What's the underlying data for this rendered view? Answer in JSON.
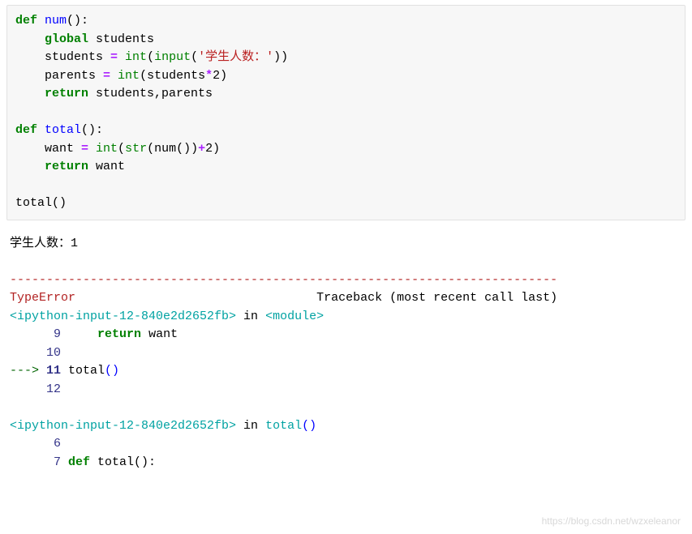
{
  "code": {
    "l1_def": "def ",
    "l1_fn": "num",
    "l1_rest": "():",
    "l2_global": "global ",
    "l2_var": "students",
    "l3_p1": "    students ",
    "l3_eq": "= ",
    "l3_int": "int",
    "l3_p2": "(",
    "l3_input": "input",
    "l3_p3": "(",
    "l3_str": "'学生人数：'",
    "l3_p4": "))",
    "l4_p1": "    parents ",
    "l4_eq": "= ",
    "l4_int": "int",
    "l4_p2": "(students",
    "l4_star": "*",
    "l4_p3": "2)",
    "l5_ret": "return ",
    "l5_rest": "students,parents",
    "l7_def": "def ",
    "l7_fn": "total",
    "l7_rest": "():",
    "l8_p1": "    want ",
    "l8_eq": "= ",
    "l8_int": "int",
    "l8_p2": "(",
    "l8_str": "str",
    "l8_p3": "(num())",
    "l8_plus": "+",
    "l8_p4": "2)",
    "l9_ret": "return ",
    "l9_rest": "want",
    "l11": "total()"
  },
  "output": {
    "stdin_line": "学生人数：1",
    "hr_chars": "---------------------------------------------------------------------------",
    "err_name": "TypeError",
    "tb_label": "                                 Traceback (most recent call last)",
    "src1_a": "<ipython-input-12-840e2d2652fb>",
    "src1_in": " in ",
    "src1_b": "<module>",
    "frame1_l9_pad": "      ",
    "frame1_l9_ln": "9",
    "frame1_l9_code_pre": "     ",
    "frame1_l9_ret": "return ",
    "frame1_l9_rest": "want",
    "frame1_l10_pad": "     ",
    "frame1_l10_ln": "10",
    "frame1_arrow": "---> ",
    "frame1_l11_ln": "11 ",
    "frame1_l11_code_p1": "total",
    "frame1_l11_code_p2": "()",
    "frame1_l12_pad": "     ",
    "frame1_l12_ln": "12",
    "src2_a": "<ipython-input-12-840e2d2652fb>",
    "src2_in": " in ",
    "src2_b": "total",
    "src2_b2": "()",
    "frame2_l6_pad": "      ",
    "frame2_l6_ln": "6",
    "frame2_l7_pad": "      ",
    "frame2_l7_ln": "7 ",
    "frame2_l7_def": "def ",
    "frame2_l7_rest": "total():"
  },
  "watermark": "https://blog.csdn.net/wzxeleanor"
}
